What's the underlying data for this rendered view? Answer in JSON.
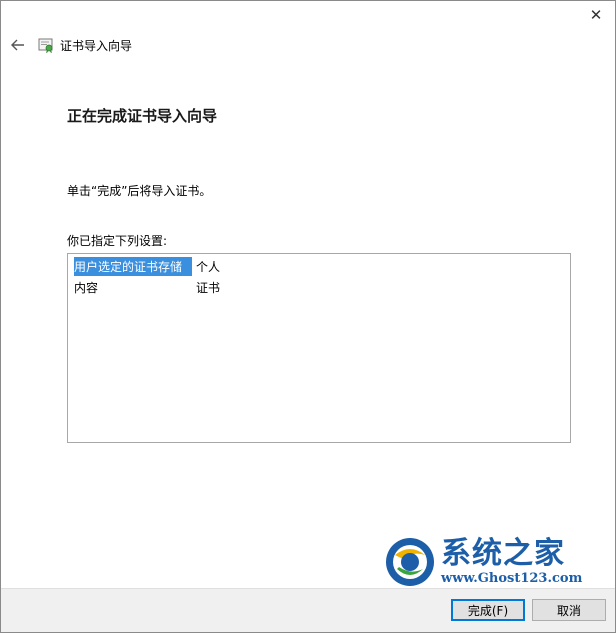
{
  "window": {
    "close_glyph": "✕",
    "header_title": "证书导入向导"
  },
  "page": {
    "title": "正在完成证书导入向导",
    "instruction": "单击“完成”后将导入证书。",
    "settings_label": "你已指定下列设置:"
  },
  "settings": {
    "rows": [
      {
        "key": "用户选定的证书存储",
        "value": "个人",
        "selected": true
      },
      {
        "key": "内容",
        "value": "证书",
        "selected": false
      }
    ]
  },
  "footer": {
    "finish_label": "完成(F)",
    "cancel_label": "取消"
  },
  "watermark": {
    "title": "系统之家",
    "url": "www.Ghost123.com"
  },
  "colors": {
    "selection": "#3a8fde",
    "accent": "#0078d7"
  }
}
